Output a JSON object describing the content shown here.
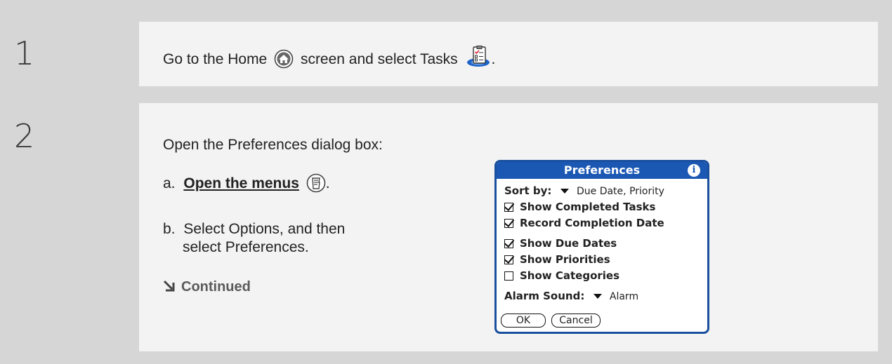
{
  "step1": {
    "number": "1",
    "text_before": "Go to the Home",
    "text_middle": "screen and select Tasks",
    "text_end": ".",
    "home_icon": "home-icon",
    "tasks_icon": "tasks-app-icon"
  },
  "step2": {
    "number": "2",
    "intro": "Open the Preferences dialog box:",
    "a_prefix": "a.",
    "a_link": "Open the menus",
    "a_suffix": ".",
    "menu_icon": "menu-icon",
    "b_prefix": "b.",
    "b_line1": "Select Options, and then",
    "b_line2": "select Preferences.",
    "continued": "Continued",
    "continued_icon": "arrow-down-right-icon"
  },
  "dialog": {
    "title": "Preferences",
    "info_glyph": "i",
    "sort_label": "Sort by:",
    "sort_value": "Due Date, Priority",
    "options": [
      {
        "label": "Show Completed Tasks",
        "checked": true
      },
      {
        "label": "Record Completion Date",
        "checked": true
      },
      {
        "label": "Show Due Dates",
        "checked": true
      },
      {
        "label": "Show Priorities",
        "checked": true
      },
      {
        "label": "Show Categories",
        "checked": false
      }
    ],
    "alarm_label": "Alarm Sound:",
    "alarm_value": "Alarm",
    "ok_label": "OK",
    "cancel_label": "Cancel"
  },
  "colors": {
    "band": "#d6d6d6",
    "panel": "#f3f3f3",
    "dialog_title": "#1b58b4",
    "dialog_border": "#1a4f9e"
  }
}
